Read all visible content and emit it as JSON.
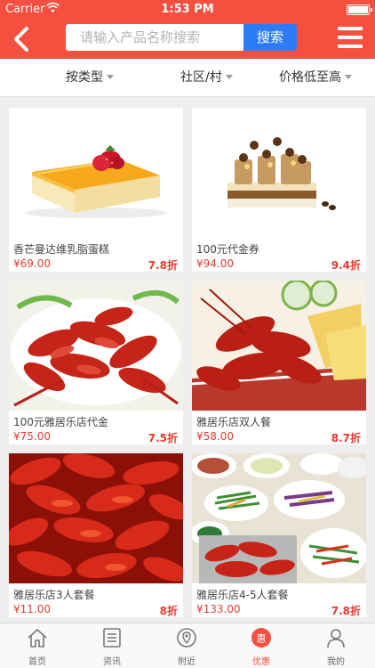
{
  "status_bar": {
    "carrier": "Carrier",
    "time": "1:53 PM"
  },
  "header": {
    "search_placeholder": "请输入产品名称搜索",
    "search_button": "搜索"
  },
  "filters": [
    {
      "label": "按类型"
    },
    {
      "label": "社区/村"
    },
    {
      "label": "价格低至高"
    }
  ],
  "products": [
    {
      "name": "香芒曼达维乳脂蛋糕",
      "price": "¥69.00",
      "discount": "7.8折"
    },
    {
      "name": "100元代金券",
      "price": "¥94.00",
      "discount": "9.4折"
    },
    {
      "name": "100元雅居乐店代金",
      "price": "¥75.00",
      "discount": "7.5折"
    },
    {
      "name": "雅居乐店双人餐",
      "price": "¥58.00",
      "discount": "8.7折"
    },
    {
      "name": "雅居乐店3人套餐",
      "price": "¥11.00",
      "discount": "8折"
    },
    {
      "name": "雅居乐店4-5人套餐",
      "price": "¥133.00",
      "discount": "7.8折"
    }
  ],
  "tabs": [
    {
      "label": "首页",
      "icon": "home-icon"
    },
    {
      "label": "资讯",
      "icon": "news-icon"
    },
    {
      "label": "附近",
      "icon": "location-icon"
    },
    {
      "label": "优惠",
      "icon": "discount-icon",
      "active": true
    },
    {
      "label": "我的",
      "icon": "profile-icon"
    }
  ],
  "colors": {
    "brand": "#f54f3f",
    "search_button": "#2d7cf6",
    "price": "#e63c2e"
  }
}
